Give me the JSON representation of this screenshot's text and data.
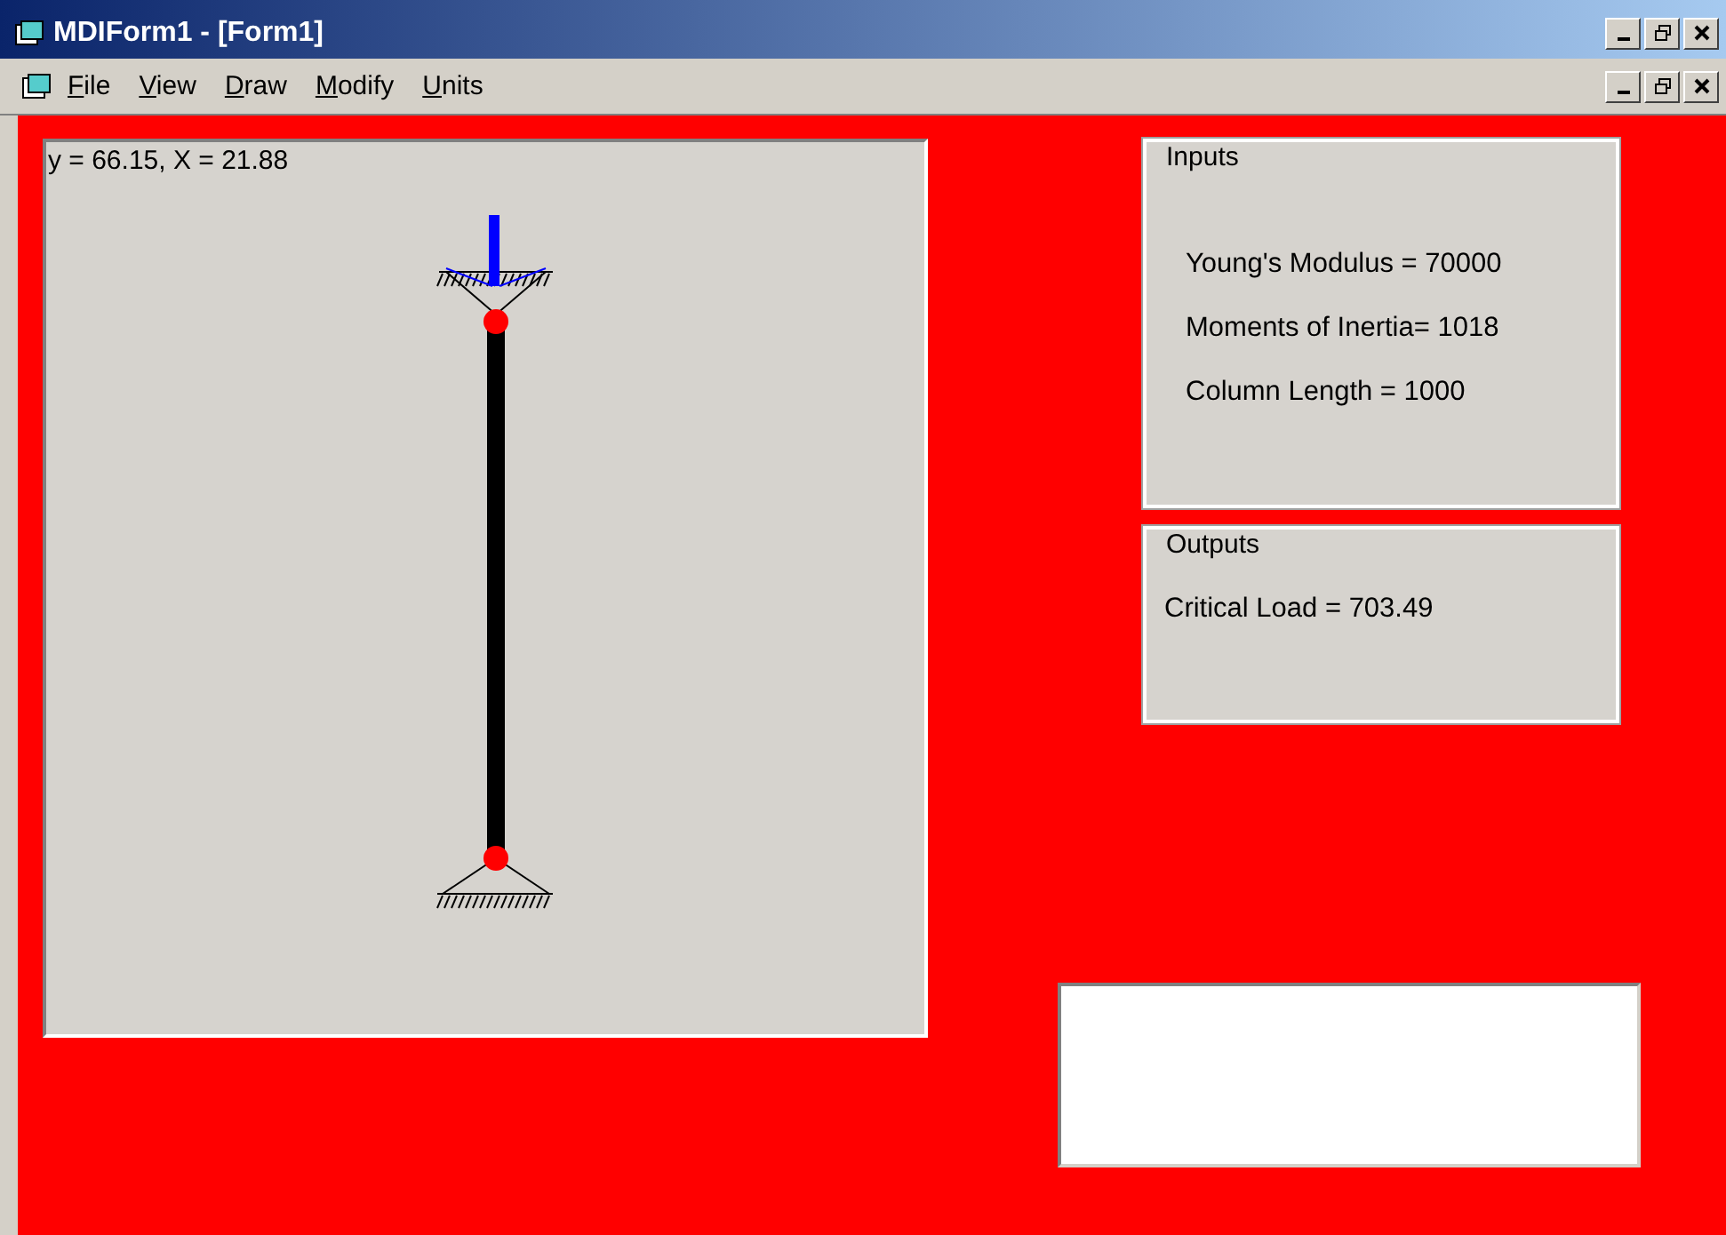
{
  "window": {
    "title": "MDIForm1 - [Form1]"
  },
  "menu": [
    {
      "label": "File"
    },
    {
      "label": "View"
    },
    {
      "label": "Draw"
    },
    {
      "label": "Modify"
    },
    {
      "label": "Units"
    }
  ],
  "canvas": {
    "readout": "y = 66.15,  X = 21.88"
  },
  "inputs": {
    "title": "Inputs",
    "lines": [
      "Young's Modulus = 70000",
      "Moments of Inertia= 1018",
      "Column Length = 1000"
    ]
  },
  "outputs": {
    "title": "Outputs",
    "lines": [
      "Critical Load = 703.49"
    ]
  }
}
